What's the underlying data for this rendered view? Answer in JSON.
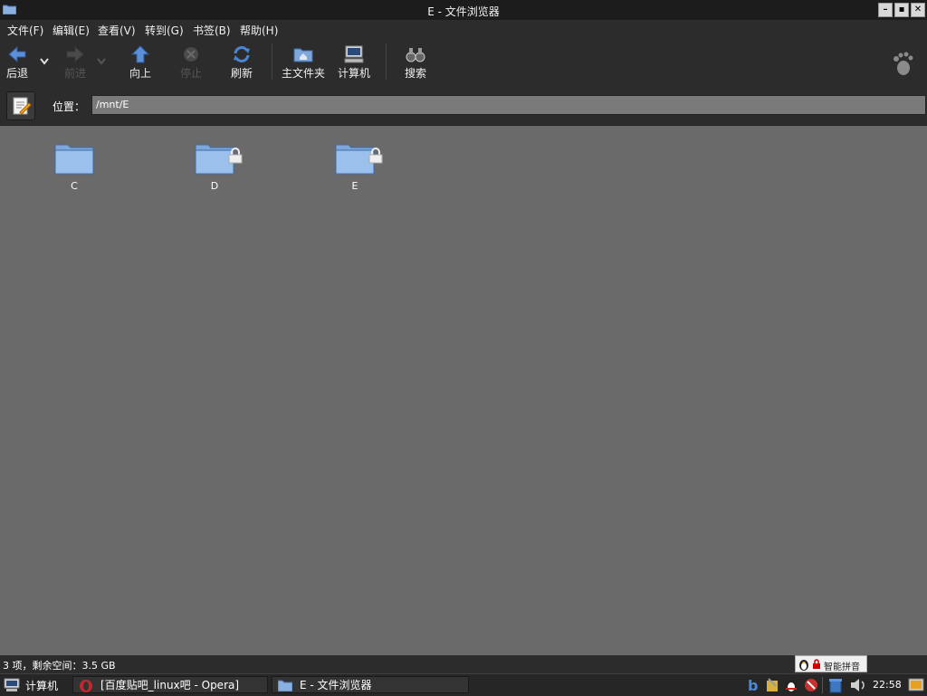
{
  "window": {
    "title": "E - 文件浏览器"
  },
  "menubar": {
    "items": [
      "文件(F)",
      "编辑(E)",
      "查看(V)",
      "转到(G)",
      "书签(B)",
      "帮助(H)"
    ]
  },
  "toolbar": {
    "back": "后退",
    "forward": "前进",
    "up": "向上",
    "stop": "停止",
    "refresh": "刷新",
    "home": "主文件夹",
    "computer": "计算机",
    "search": "搜索"
  },
  "location": {
    "label": "位置：",
    "path": "/mnt/E"
  },
  "folders": [
    {
      "name": "C",
      "locked": false
    },
    {
      "name": "D",
      "locked": true
    },
    {
      "name": "E",
      "locked": true
    }
  ],
  "status": {
    "text": "3 项，剩余空间：3.5 GB"
  },
  "ime": {
    "text": "智能拼音"
  },
  "taskbar": {
    "start_label": "计算机",
    "tasks": [
      "[百度贴吧_linux吧 - Opera]",
      "E - 文件浏览器"
    ],
    "clock": "22:58"
  }
}
